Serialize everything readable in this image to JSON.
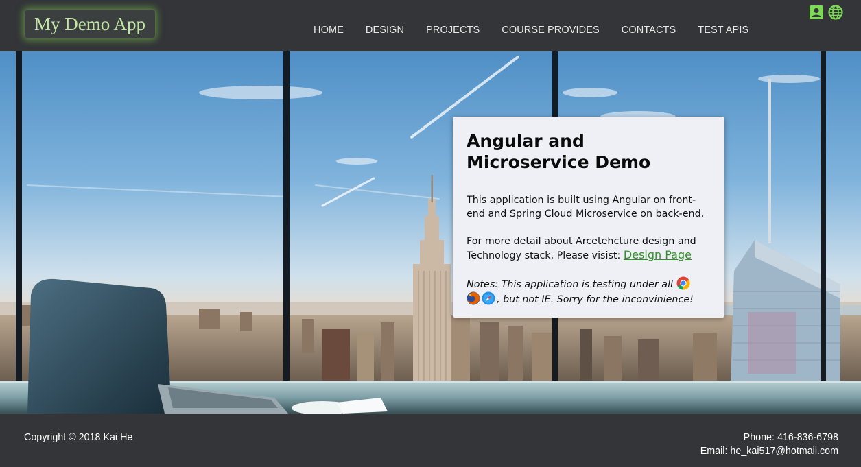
{
  "header": {
    "logo_text": "My Demo App",
    "nav": [
      {
        "label": "HOME"
      },
      {
        "label": "DESIGN"
      },
      {
        "label": "PROJECTS"
      },
      {
        "label": "COURSE PROVIDES"
      },
      {
        "label": "CONTACTS"
      },
      {
        "label": "TEST APIS"
      }
    ],
    "icons": [
      "contact-card-icon",
      "globe-icon"
    ],
    "accent_color": "#7ed957"
  },
  "hero": {
    "background": "office-window-city-skyline"
  },
  "card": {
    "title": "Angular and Microservice Demo",
    "intro": "This application is built using Angular on front-end and Spring Cloud Microservice on back-end.",
    "detail_text": "For more detail about Arcetehcture design and Technology stack, Please visist: ",
    "design_link": "Design Page",
    "notes_prefix": "Notes: This application is testing under all",
    "notes_suffix": ", but not IE. Sorry for the inconvinience!",
    "browser_icons": [
      "chrome-icon",
      "firefox-icon",
      "safari-icon"
    ],
    "link_color": "#2f9225"
  },
  "footer": {
    "copyright": "Copyright © 2018 Kai He",
    "phone": "Phone: 416-836-6798",
    "email": "Email: he_kai517@hotmail.com"
  }
}
